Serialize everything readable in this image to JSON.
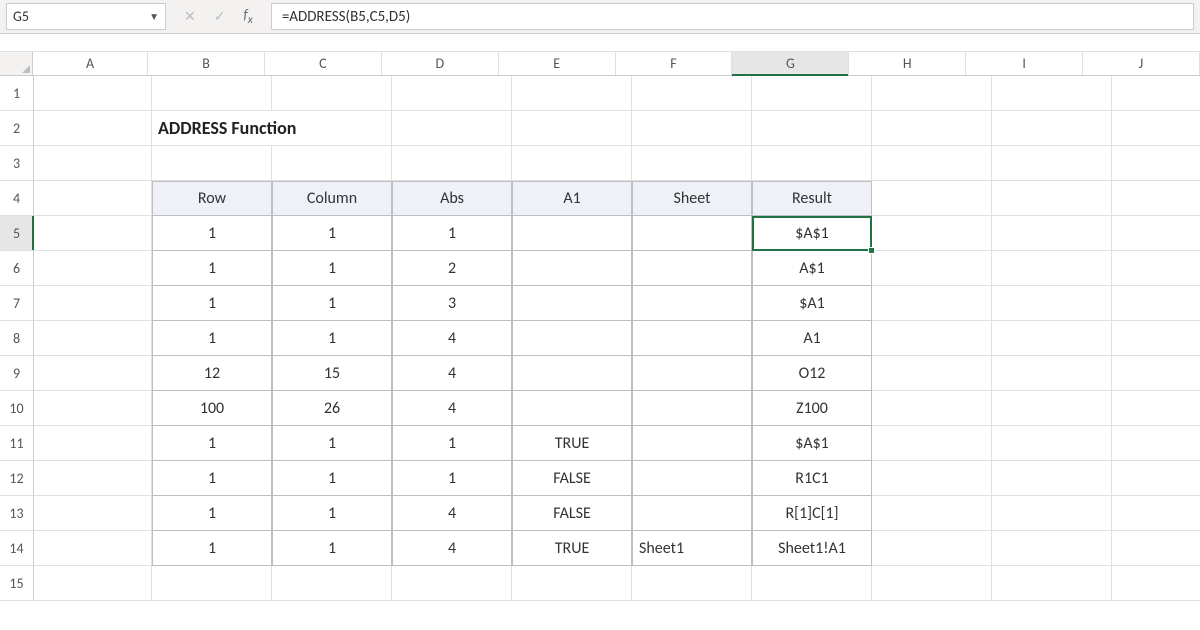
{
  "name_box": "G5",
  "formula": "=ADDRESS(B5,C5,D5)",
  "columns": [
    "A",
    "B",
    "C",
    "D",
    "E",
    "F",
    "G",
    "H",
    "I",
    "J"
  ],
  "active_col": "G",
  "active_row": 5,
  "row_numbers": [
    1,
    2,
    3,
    4,
    5,
    6,
    7,
    8,
    9,
    10,
    11,
    12,
    13,
    14,
    15
  ],
  "title": "ADDRESS Function",
  "headers": {
    "row": "Row",
    "col": "Column",
    "abs": "Abs",
    "a1": "A1",
    "sheet": "Sheet",
    "result": "Result"
  },
  "rows": [
    {
      "row": "1",
      "col": "1",
      "abs": "1",
      "a1": "",
      "sheet": "",
      "result": "$A$1"
    },
    {
      "row": "1",
      "col": "1",
      "abs": "2",
      "a1": "",
      "sheet": "",
      "result": "A$1"
    },
    {
      "row": "1",
      "col": "1",
      "abs": "3",
      "a1": "",
      "sheet": "",
      "result": "$A1"
    },
    {
      "row": "1",
      "col": "1",
      "abs": "4",
      "a1": "",
      "sheet": "",
      "result": "A1"
    },
    {
      "row": "12",
      "col": "15",
      "abs": "4",
      "a1": "",
      "sheet": "",
      "result": "O12"
    },
    {
      "row": "100",
      "col": "26",
      "abs": "4",
      "a1": "",
      "sheet": "",
      "result": "Z100"
    },
    {
      "row": "1",
      "col": "1",
      "abs": "1",
      "a1": "TRUE",
      "sheet": "",
      "result": "$A$1"
    },
    {
      "row": "1",
      "col": "1",
      "abs": "1",
      "a1": "FALSE",
      "sheet": "",
      "result": "R1C1"
    },
    {
      "row": "1",
      "col": "1",
      "abs": "4",
      "a1": "FALSE",
      "sheet": "",
      "result": "R[1]C[1]"
    },
    {
      "row": "1",
      "col": "1",
      "abs": "4",
      "a1": "TRUE",
      "sheet": "Sheet1",
      "result": "Sheet1!A1"
    }
  ],
  "chart_data": {
    "type": "table",
    "title": "ADDRESS Function",
    "columns": [
      "Row",
      "Column",
      "Abs",
      "A1",
      "Sheet",
      "Result"
    ],
    "rows": [
      [
        1,
        1,
        1,
        "",
        "",
        "$A$1"
      ],
      [
        1,
        1,
        2,
        "",
        "",
        "A$1"
      ],
      [
        1,
        1,
        3,
        "",
        "",
        "$A1"
      ],
      [
        1,
        1,
        4,
        "",
        "",
        "A1"
      ],
      [
        12,
        15,
        4,
        "",
        "",
        "O12"
      ],
      [
        100,
        26,
        4,
        "",
        "",
        "Z100"
      ],
      [
        1,
        1,
        1,
        "TRUE",
        "",
        "$A$1"
      ],
      [
        1,
        1,
        1,
        "FALSE",
        "",
        "R1C1"
      ],
      [
        1,
        1,
        4,
        "FALSE",
        "",
        "R[1]C[1]"
      ],
      [
        1,
        1,
        4,
        "TRUE",
        "Sheet1",
        "Sheet1!A1"
      ]
    ]
  }
}
